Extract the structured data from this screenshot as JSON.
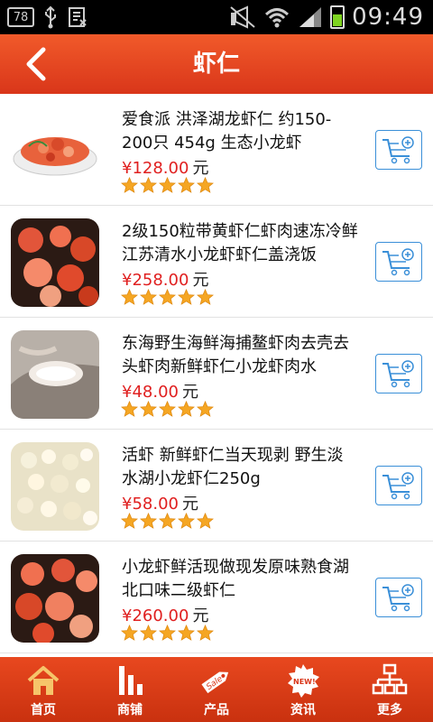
{
  "status": {
    "badge": "78",
    "time": "09:49"
  },
  "header": {
    "title": "虾仁"
  },
  "unit_label": "元",
  "products": [
    {
      "name": "爱食派 洪泽湖龙虾仁 约150-200只 454g 生态小龙虾",
      "price": "¥128.00",
      "rating": 5
    },
    {
      "name": "2级150粒带黄虾仁虾肉速冻冷鲜江苏清水小龙虾虾仁盖浇饭",
      "price": "¥258.00",
      "rating": 5
    },
    {
      "name": "东海野生海鲜海捕鳌虾肉去壳去头虾肉新鲜虾仁小龙虾肉水",
      "price": "¥48.00",
      "rating": 5
    },
    {
      "name": "活虾 新鲜虾仁当天现剥 野生淡水湖小龙虾仁250g",
      "price": "¥58.00",
      "rating": 5
    },
    {
      "name": "小龙虾鲜活现做现发原味熟食湖北口味二级虾仁",
      "price": "¥260.00",
      "rating": 5
    }
  ],
  "nav": [
    {
      "label": "首页",
      "icon": "home-icon"
    },
    {
      "label": "商铺",
      "icon": "bar-chart-icon"
    },
    {
      "label": "产品",
      "icon": "sale-tag-icon"
    },
    {
      "label": "资讯",
      "icon": "new-badge-icon"
    },
    {
      "label": "更多",
      "icon": "sitemap-icon"
    }
  ],
  "colors": {
    "header": "#e8481f",
    "price": "#e02020",
    "star": "#f5a623",
    "cart_border": "#3a8fd8"
  }
}
